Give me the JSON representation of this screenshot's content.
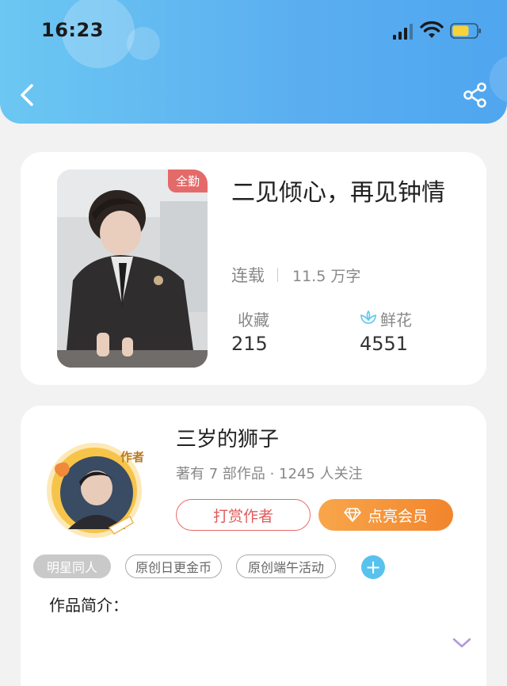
{
  "status_bar": {
    "time": "16:23"
  },
  "book": {
    "badge": "全勤",
    "title": "二见倾心，再见钟情",
    "status": "连载",
    "word_count": "11.5 万字",
    "stats": [
      {
        "label": "收藏",
        "value": "215"
      },
      {
        "label": "鲜花",
        "value": "4551"
      }
    ]
  },
  "author": {
    "avatar_badge": "作者",
    "name": "三岁的狮子",
    "meta": "著有 7 部作品 · 1245 人关注",
    "tip_button": "打赏作者",
    "vip_button": "点亮会员"
  },
  "tags": [
    "明星同人",
    "原创日更金币",
    "原创端午活动"
  ],
  "add_tag": "+",
  "intro_label": "作品简介："
}
